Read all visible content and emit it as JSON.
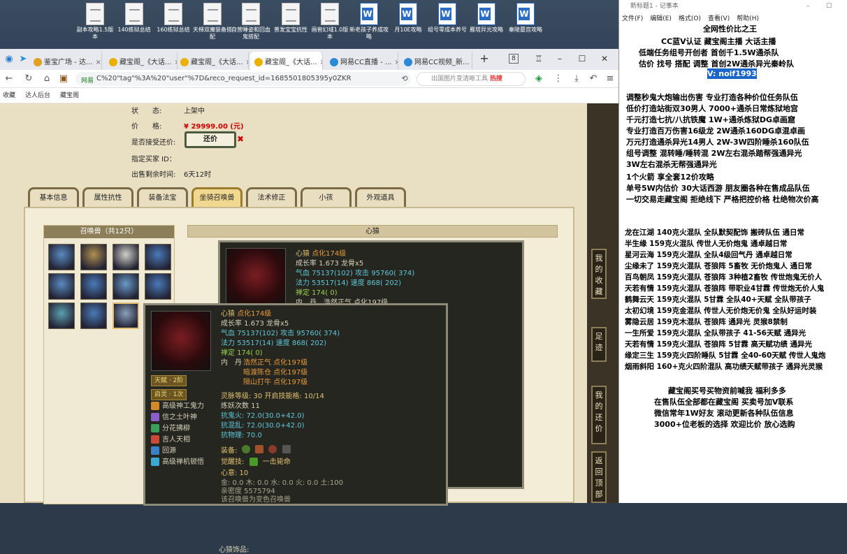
{
  "desktop_icons": [
    {
      "label": "副本攻略1.5版本",
      "type": "txt"
    },
    {
      "label": "140练狱总结",
      "type": "txt"
    },
    {
      "label": "160练狱总结",
      "type": "txt"
    },
    {
      "label": "天梯双魔装备搭配",
      "type": "txt"
    },
    {
      "label": "自营睡姿和回血鬼搭配",
      "type": "txt"
    },
    {
      "label": "普发宝宝抗性",
      "type": "txt"
    },
    {
      "label": "画窖幻域1.0版本",
      "type": "txt"
    },
    {
      "label": "新老孩子养成攻略",
      "type": "word"
    },
    {
      "label": "月10E攻略",
      "type": "word"
    },
    {
      "label": "组号零成本养号",
      "type": "word"
    },
    {
      "label": "雁塔异光攻略",
      "type": "word"
    },
    {
      "label": "秦陵墓宫攻略",
      "type": "word"
    }
  ],
  "browser": {
    "tabs": [
      {
        "label": "鉴宝广场 - 达...",
        "color": "#e0a020"
      },
      {
        "label": "藏宝阁_《大话...",
        "color": "#e9b000"
      },
      {
        "label": "藏宝阁_《大话...",
        "color": "#e9b000"
      },
      {
        "label": "藏宝阁_《大话...",
        "color": "#e9b000",
        "active": true
      },
      {
        "label": "网易CC直播 - ...",
        "color": "#2a8ad6"
      },
      {
        "label": "网易CC视频_新...",
        "color": "#2a8ad6"
      }
    ],
    "tab_count": "8",
    "new_tab": "+",
    "url_tag": "网易",
    "url": "C%20\"tag\"%3A%20\"user\"%7D&reco_request_id=1685501805395y0ZKR",
    "search_placeholder": "出国图片变清晰工具",
    "search_hot": "热搜",
    "bookmarks": [
      "收藏",
      "达人后台",
      "藏宝阁"
    ]
  },
  "listing": {
    "status_label": "状　　态:",
    "status_value": "上架中",
    "price_label": "价　　格:",
    "price_value": "¥ 29999.00 (元)",
    "offer_label": "是否接受还价:",
    "offer_button": "还价",
    "buyer_label": "指定买家 ID：",
    "time_label": "出售剩余时间:",
    "time_value": "6天12时"
  },
  "game_tabs": [
    "基本信息",
    "属性抗性",
    "装备法宝",
    "坐骑召唤兽",
    "法术修正",
    "小孩",
    "外观道具"
  ],
  "pet_list_title": "召唤兽（共12只）",
  "detail_title": "心猿",
  "tooltip_back": {
    "name": "心猿",
    "tag": "点化174级",
    "growth": "成长率 1.673 龙骨x5",
    "hp": "气血 75137(102) 攻击 95760( 374)",
    "mp": "法力 53517(14) 速度 868( 202)",
    "zen": "禅定 174( 0)",
    "cut": "内　丹　浩然正气 点化197级"
  },
  "tooltip_front": {
    "name": "心猿",
    "tag": "点化174级",
    "growth": "成长率 1.673 龙骨x5",
    "hp_label": "气血",
    "hp": "75137(102)",
    "atk_label": "攻击",
    "atk": "95760( 374)",
    "mp_label": "法力",
    "mp": "53517(14)",
    "spd_label": "速度",
    "spd": "868( 202)",
    "zen": "禅定 174( 0)",
    "neidan_label": "内　丹",
    "neidan1": "浩然正气 点化197级",
    "neidan2": "暗渡陈仓 点化197级",
    "neidan3": "隔山打牛 点化197级",
    "tianfu": "天赋 · 2阶",
    "qiling": "启灵 · 1次",
    "skills": [
      "高级神工鬼力",
      "信之土叶神",
      "分花拂柳",
      "吉人天相",
      "回源",
      "高级禅机顿悟"
    ],
    "skill_colors": [
      "#d08a2a",
      "#8a5fc8",
      "#3a9f5a",
      "#c94a3a",
      "#3a7fc8",
      "#3aa8d0"
    ],
    "lingyuan": "灵脉等级:  30  开启技能格:  10/14",
    "lianyao": "炼妖次数 11",
    "fire": "抗鬼火: 72.0(30.0+42.0)",
    "thunder": "抗混乱: 72.0(30.0+42.0)",
    "phys": "抗物理: 70.0",
    "equip_label": "装备:",
    "awaken_label": "觉醒技:",
    "awaken": "一击毙命",
    "xinyi": "心意:  10",
    "elements": "金: 0.0 木: 0.0 水: 0.0 火: 0.0 土:100",
    "intimacy": "亲密度 5575794",
    "color_note": "该召唤兽为变色召唤兽",
    "ornament": "心猿饰品:"
  },
  "side_buttons": [
    "我的收藏",
    "足迹",
    "我的还价",
    "返回顶部"
  ],
  "notepad": {
    "title": "新标题1 - 记事本",
    "menu": [
      "文件(F)",
      "编辑(E)",
      "格式(O)",
      "查看(V)",
      "帮助(H)"
    ],
    "lines": [
      "全网性价比之王",
      "CC蓝V认证  藏宝阁主播  大话主播",
      "低端任务组号开创者   首创千1.5W通杀队",
      "估价 找号 搭配 调整      首创2W通杀异光秦岭队",
      "V: noif1993",
      "调整秒鬼大炮输出伤害        专业打造各种价位任务队伍",
      "低价打造站街双30男人           7000+通杀日常炼狱地宫",
      "千元打造七抗/八抗铁魔          1W+通杀炼狱DG卓画窟",
      "专业打造百万伤害16级龙          2W通杀160DG卓混卓画",
      "万元打造通杀异光14男人        2W-3W四阶睡杀160队伍",
      "组号调整 混转睡/睡转混          2W左右混杀踏帮强通异光",
      "                                          3W左右混杀无帮强通异光",
      "1个火箭 享全套12价攻略",
      "单号5W内估价 30大话西游         朋友圈各种在售成品队伍",
      "一切交易走藏宝阁 拒绝线下     严格把控价格 杜绝物次价高",
      "龙在江湖 140克火混队  全队默契配饰  搬砖队伍  通日常",
      "半生缘      159克火混队  传世人无价炮鬼  通卓越日常",
      "星河云海  159克火混队  全队4级回气丹  通卓越日常",
      "尘缘未了  159克火混队  苍狼阵  5畜牧  无价炮鬼人  通日常",
      "百鸟朝凤  159克火混队  苍狼阵  3种植2畜牧  传世炮鬼无价人",
      "天若有情  159克火混队  苍狼阵  带职业4甘霖  传世炮无价人鬼",
      "鹤舞云天  159克火混队  5甘霖  全队40+天赋  全队带孩子",
      "太初幻境  159克金混队  传世人无价炮无价鬼  全队好运时装",
      "雾隐云居  159克木混队  苍狼阵  通异光  灵猴8禁制",
      "一生所爱  159克火混队  全队带孩子  41-56天赋  通异光",
      "天若有情  159克火混队  苍狼阵  5甘霖  高天赋功绩  通异光",
      "缘定三生  159克火四阶睡队  5甘霖  全40-60天赋  传世人鬼炮",
      "烟雨斜阳  160+克火四阶混队  高功绩天赋带孩子  通异光灵猴",
      "藏宝阁买号买物资前喊我  福利多多",
      "在售队伍全部都在藏宝阁  买卖号加V联系",
      "微信常年1W好友  滚动更新各种队伍信息",
      "3000+位老板的选择  欢迎比价  放心选购"
    ]
  }
}
